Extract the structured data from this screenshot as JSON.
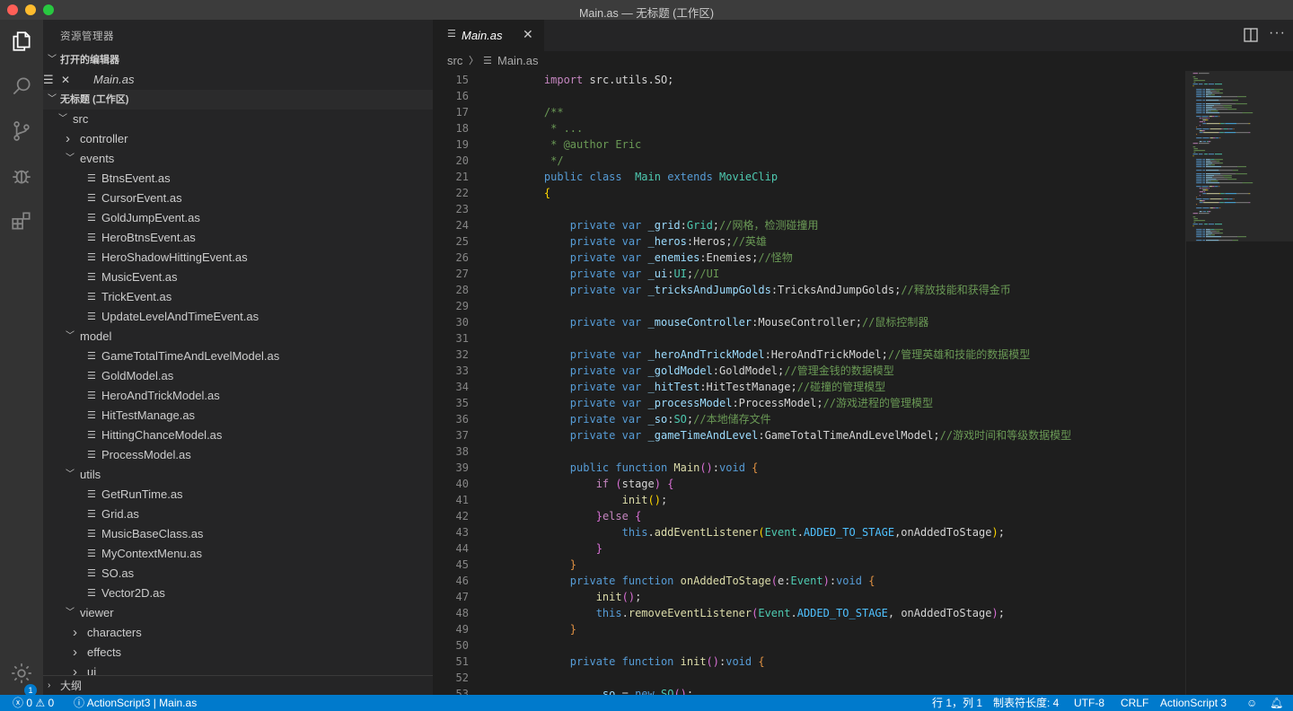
{
  "window": {
    "title": "Main.as — 无标题 (工作区)"
  },
  "activity": {
    "settings_badge": "1"
  },
  "sidebar": {
    "title": "资源管理器",
    "open_editors_label": "打开的编辑器",
    "open_editor_file": "Main.as",
    "workspace_label": "无标题 (工作区)",
    "outline_label": "大纲",
    "tree": [
      {
        "label": "src",
        "depth": 0,
        "kind": "folder-open"
      },
      {
        "label": "controller",
        "depth": 1,
        "kind": "folder-closed"
      },
      {
        "label": "events",
        "depth": 1,
        "kind": "folder-open"
      },
      {
        "label": "BtnsEvent.as",
        "depth": 2,
        "kind": "file"
      },
      {
        "label": "CursorEvent.as",
        "depth": 2,
        "kind": "file"
      },
      {
        "label": "GoldJumpEvent.as",
        "depth": 2,
        "kind": "file"
      },
      {
        "label": "HeroBtnsEvent.as",
        "depth": 2,
        "kind": "file"
      },
      {
        "label": "HeroShadowHittingEvent.as",
        "depth": 2,
        "kind": "file"
      },
      {
        "label": "MusicEvent.as",
        "depth": 2,
        "kind": "file"
      },
      {
        "label": "TrickEvent.as",
        "depth": 2,
        "kind": "file"
      },
      {
        "label": "UpdateLevelAndTimeEvent.as",
        "depth": 2,
        "kind": "file"
      },
      {
        "label": "model",
        "depth": 1,
        "kind": "folder-open"
      },
      {
        "label": "GameTotalTimeAndLevelModel.as",
        "depth": 2,
        "kind": "file"
      },
      {
        "label": "GoldModel.as",
        "depth": 2,
        "kind": "file"
      },
      {
        "label": "HeroAndTrickModel.as",
        "depth": 2,
        "kind": "file"
      },
      {
        "label": "HitTestManage.as",
        "depth": 2,
        "kind": "file"
      },
      {
        "label": "HittingChanceModel.as",
        "depth": 2,
        "kind": "file"
      },
      {
        "label": "ProcessModel.as",
        "depth": 2,
        "kind": "file"
      },
      {
        "label": "utils",
        "depth": 1,
        "kind": "folder-open"
      },
      {
        "label": "GetRunTime.as",
        "depth": 2,
        "kind": "file"
      },
      {
        "label": "Grid.as",
        "depth": 2,
        "kind": "file"
      },
      {
        "label": "MusicBaseClass.as",
        "depth": 2,
        "kind": "file"
      },
      {
        "label": "MyContextMenu.as",
        "depth": 2,
        "kind": "file"
      },
      {
        "label": "SO.as",
        "depth": 2,
        "kind": "file"
      },
      {
        "label": "Vector2D.as",
        "depth": 2,
        "kind": "file"
      },
      {
        "label": "viewer",
        "depth": 1,
        "kind": "folder-open"
      },
      {
        "label": "characters",
        "depth": 2,
        "kind": "folder-closed"
      },
      {
        "label": "effects",
        "depth": 2,
        "kind": "folder-closed"
      },
      {
        "label": "ui",
        "depth": 2,
        "kind": "folder-closed"
      }
    ]
  },
  "editor": {
    "tab_label": "Main.as",
    "breadcrumb": {
      "folder": "src",
      "file": "Main.as"
    },
    "lines": [
      {
        "n": "15",
        "t": [
          [
            "    ",
            ""
          ],
          [
            "import",
            "kw2"
          ],
          [
            " src.utils.SO;",
            ""
          ]
        ]
      },
      {
        "n": "16",
        "t": []
      },
      {
        "n": "17",
        "t": [
          [
            "    /**",
            "cm"
          ]
        ]
      },
      {
        "n": "18",
        "t": [
          [
            "     * ...",
            "cm"
          ]
        ]
      },
      {
        "n": "19",
        "t": [
          [
            "     * @author Eric",
            "cm"
          ]
        ]
      },
      {
        "n": "20",
        "t": [
          [
            "     */",
            "cm"
          ]
        ]
      },
      {
        "n": "21",
        "t": [
          [
            "    ",
            ""
          ],
          [
            "public",
            "kw"
          ],
          [
            " ",
            ""
          ],
          [
            "class",
            "kw"
          ],
          [
            "  ",
            ""
          ],
          [
            "Main",
            "ty"
          ],
          [
            " ",
            ""
          ],
          [
            "extends",
            "kw"
          ],
          [
            " ",
            ""
          ],
          [
            "MovieClip",
            "ty"
          ]
        ]
      },
      {
        "n": "22",
        "t": [
          [
            "    ",
            ""
          ],
          [
            "{",
            "br"
          ]
        ]
      },
      {
        "n": "23",
        "t": []
      },
      {
        "n": "24",
        "t": [
          [
            "        ",
            ""
          ],
          [
            "private",
            "kw"
          ],
          [
            " ",
            ""
          ],
          [
            "var",
            "kw"
          ],
          [
            " ",
            ""
          ],
          [
            "_grid",
            "vr"
          ],
          [
            ":",
            ""
          ],
          [
            "Grid",
            "ty"
          ],
          [
            ";",
            ""
          ],
          [
            "//网格，检测碰撞用",
            "cm"
          ]
        ]
      },
      {
        "n": "25",
        "t": [
          [
            "        ",
            ""
          ],
          [
            "private",
            "kw"
          ],
          [
            " ",
            ""
          ],
          [
            "var",
            "kw"
          ],
          [
            " ",
            ""
          ],
          [
            "_heros",
            "vr"
          ],
          [
            ":Heros;",
            ""
          ],
          [
            "//英雄",
            "cm"
          ]
        ]
      },
      {
        "n": "26",
        "t": [
          [
            "        ",
            ""
          ],
          [
            "private",
            "kw"
          ],
          [
            " ",
            ""
          ],
          [
            "var",
            "kw"
          ],
          [
            " ",
            ""
          ],
          [
            "_enemies",
            "vr"
          ],
          [
            ":Enemies;",
            ""
          ],
          [
            "//怪物",
            "cm"
          ]
        ]
      },
      {
        "n": "27",
        "t": [
          [
            "        ",
            ""
          ],
          [
            "private",
            "kw"
          ],
          [
            " ",
            ""
          ],
          [
            "var",
            "kw"
          ],
          [
            " ",
            ""
          ],
          [
            "_ui",
            "vr"
          ],
          [
            ":",
            ""
          ],
          [
            "UI",
            "ty"
          ],
          [
            ";",
            ""
          ],
          [
            "//UI",
            "cm"
          ]
        ]
      },
      {
        "n": "28",
        "t": [
          [
            "        ",
            ""
          ],
          [
            "private",
            "kw"
          ],
          [
            " ",
            ""
          ],
          [
            "var",
            "kw"
          ],
          [
            " ",
            ""
          ],
          [
            "_tricksAndJumpGolds",
            "vr"
          ],
          [
            ":TricksAndJumpGolds;",
            ""
          ],
          [
            "//释放技能和获得金币",
            "cm"
          ]
        ]
      },
      {
        "n": "29",
        "t": []
      },
      {
        "n": "30",
        "t": [
          [
            "        ",
            ""
          ],
          [
            "private",
            "kw"
          ],
          [
            " ",
            ""
          ],
          [
            "var",
            "kw"
          ],
          [
            " ",
            ""
          ],
          [
            "_mouseController",
            "vr"
          ],
          [
            ":MouseController;",
            ""
          ],
          [
            "//鼠标控制器",
            "cm"
          ]
        ]
      },
      {
        "n": "31",
        "t": []
      },
      {
        "n": "32",
        "t": [
          [
            "        ",
            ""
          ],
          [
            "private",
            "kw"
          ],
          [
            " ",
            ""
          ],
          [
            "var",
            "kw"
          ],
          [
            " ",
            ""
          ],
          [
            "_heroAndTrickModel",
            "vr"
          ],
          [
            ":HeroAndTrickModel;",
            ""
          ],
          [
            "//管理英雄和技能的数据模型",
            "cm"
          ]
        ]
      },
      {
        "n": "33",
        "t": [
          [
            "        ",
            ""
          ],
          [
            "private",
            "kw"
          ],
          [
            " ",
            ""
          ],
          [
            "var",
            "kw"
          ],
          [
            " ",
            ""
          ],
          [
            "_goldModel",
            "vr"
          ],
          [
            ":GoldModel;",
            ""
          ],
          [
            "//管理金钱的数据模型",
            "cm"
          ]
        ]
      },
      {
        "n": "34",
        "t": [
          [
            "        ",
            ""
          ],
          [
            "private",
            "kw"
          ],
          [
            " ",
            ""
          ],
          [
            "var",
            "kw"
          ],
          [
            " ",
            ""
          ],
          [
            "_hitTest",
            "vr"
          ],
          [
            ":HitTestManage;",
            ""
          ],
          [
            "//碰撞的管理模型",
            "cm"
          ]
        ]
      },
      {
        "n": "35",
        "t": [
          [
            "        ",
            ""
          ],
          [
            "private",
            "kw"
          ],
          [
            " ",
            ""
          ],
          [
            "var",
            "kw"
          ],
          [
            " ",
            ""
          ],
          [
            "_processModel",
            "vr"
          ],
          [
            ":ProcessModel;",
            ""
          ],
          [
            "//游戏进程的管理模型",
            "cm"
          ]
        ]
      },
      {
        "n": "36",
        "t": [
          [
            "        ",
            ""
          ],
          [
            "private",
            "kw"
          ],
          [
            " ",
            ""
          ],
          [
            "var",
            "kw"
          ],
          [
            " ",
            ""
          ],
          [
            "_so",
            "vr"
          ],
          [
            ":",
            ""
          ],
          [
            "SO",
            "ty"
          ],
          [
            ";",
            ""
          ],
          [
            "//本地储存文件",
            "cm"
          ]
        ]
      },
      {
        "n": "37",
        "t": [
          [
            "        ",
            ""
          ],
          [
            "private",
            "kw"
          ],
          [
            " ",
            ""
          ],
          [
            "var",
            "kw"
          ],
          [
            " ",
            ""
          ],
          [
            "_gameTimeAndLevel",
            "vr"
          ],
          [
            ":GameTotalTimeAndLevelModel;",
            ""
          ],
          [
            "//游戏时间和等级数据模型",
            "cm"
          ]
        ]
      },
      {
        "n": "38",
        "t": []
      },
      {
        "n": "39",
        "t": [
          [
            "        ",
            ""
          ],
          [
            "public",
            "kw"
          ],
          [
            " ",
            ""
          ],
          [
            "function",
            "kw"
          ],
          [
            " ",
            ""
          ],
          [
            "Main",
            "fn"
          ],
          [
            "()",
            "br2"
          ],
          [
            ":",
            ""
          ],
          [
            "void",
            "kw"
          ],
          [
            " ",
            ""
          ],
          [
            "{",
            "br3"
          ]
        ]
      },
      {
        "n": "40",
        "t": [
          [
            "            ",
            ""
          ],
          [
            "if",
            "kw2"
          ],
          [
            " ",
            ""
          ],
          [
            "(",
            "br2"
          ],
          [
            "stage",
            ""
          ],
          [
            ")",
            "br2"
          ],
          [
            " ",
            ""
          ],
          [
            "{",
            "br2"
          ]
        ]
      },
      {
        "n": "41",
        "t": [
          [
            "                ",
            ""
          ],
          [
            "init",
            "fn"
          ],
          [
            "()",
            "br"
          ],
          [
            ";",
            ""
          ]
        ]
      },
      {
        "n": "42",
        "t": [
          [
            "            ",
            ""
          ],
          [
            "}",
            "br2"
          ],
          [
            "else",
            "kw2"
          ],
          [
            " ",
            ""
          ],
          [
            "{",
            "br2"
          ]
        ]
      },
      {
        "n": "43",
        "t": [
          [
            "                ",
            ""
          ],
          [
            "this",
            "kw"
          ],
          [
            ".",
            ""
          ],
          [
            "addEventListener",
            "fn"
          ],
          [
            "(",
            "br"
          ],
          [
            "Event",
            "ty"
          ],
          [
            ".",
            ""
          ],
          [
            "ADDED_TO_STAGE",
            "cst"
          ],
          [
            ",onAddedToStage",
            ""
          ],
          [
            ")",
            "br"
          ],
          [
            ";",
            ""
          ]
        ]
      },
      {
        "n": "44",
        "t": [
          [
            "            ",
            ""
          ],
          [
            "}",
            "br2"
          ]
        ]
      },
      {
        "n": "45",
        "t": [
          [
            "        ",
            ""
          ],
          [
            "}",
            "br3"
          ]
        ]
      },
      {
        "n": "46",
        "t": [
          [
            "        ",
            ""
          ],
          [
            "private",
            "kw"
          ],
          [
            " ",
            ""
          ],
          [
            "function",
            "kw"
          ],
          [
            " ",
            ""
          ],
          [
            "onAddedToStage",
            "fn"
          ],
          [
            "(",
            "br2"
          ],
          [
            "e:",
            ""
          ],
          [
            "Event",
            "ty"
          ],
          [
            ")",
            "br2"
          ],
          [
            ":",
            ""
          ],
          [
            "void",
            "kw"
          ],
          [
            " ",
            ""
          ],
          [
            "{",
            "br3"
          ]
        ]
      },
      {
        "n": "47",
        "t": [
          [
            "            ",
            ""
          ],
          [
            "init",
            "fn"
          ],
          [
            "()",
            "br2"
          ],
          [
            ";",
            ""
          ]
        ]
      },
      {
        "n": "48",
        "t": [
          [
            "            ",
            ""
          ],
          [
            "this",
            "kw"
          ],
          [
            ".",
            ""
          ],
          [
            "removeEventListener",
            "fn"
          ],
          [
            "(",
            "br2"
          ],
          [
            "Event",
            "ty"
          ],
          [
            ".",
            ""
          ],
          [
            "ADDED_TO_STAGE",
            "cst"
          ],
          [
            ", onAddedToStage",
            ""
          ],
          [
            ")",
            "br2"
          ],
          [
            ";",
            ""
          ]
        ]
      },
      {
        "n": "49",
        "t": [
          [
            "        ",
            ""
          ],
          [
            "}",
            "br3"
          ]
        ]
      },
      {
        "n": "50",
        "t": []
      },
      {
        "n": "51",
        "t": [
          [
            "        ",
            ""
          ],
          [
            "private",
            "kw"
          ],
          [
            " ",
            ""
          ],
          [
            "function",
            "kw"
          ],
          [
            " ",
            ""
          ],
          [
            "init",
            "fn"
          ],
          [
            "()",
            "br2"
          ],
          [
            ":",
            ""
          ],
          [
            "void",
            "kw"
          ],
          [
            " ",
            ""
          ],
          [
            "{",
            "br3"
          ]
        ]
      },
      {
        "n": "52",
        "t": []
      },
      {
        "n": "53",
        "t": [
          [
            "            ",
            ""
          ],
          [
            "_so",
            "vr"
          ],
          [
            " = ",
            ""
          ],
          [
            "new",
            "kw"
          ],
          [
            " ",
            ""
          ],
          [
            "SO",
            "ty"
          ],
          [
            "()",
            "br2"
          ],
          [
            ";",
            ""
          ]
        ]
      }
    ]
  },
  "status": {
    "errors": "0",
    "warnings": "0",
    "language_info": "ActionScript3 | Main.as",
    "position": "行 1，列 1",
    "tab_size": "制表符长度: 4",
    "encoding": "UTF-8",
    "eol": "CRLF",
    "language": "ActionScript 3"
  }
}
